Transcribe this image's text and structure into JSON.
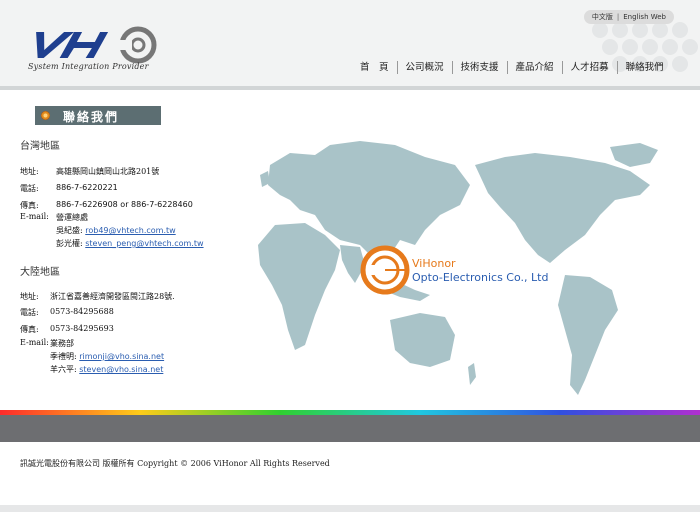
{
  "header": {
    "logo_tagline": "System Integration Provider",
    "lang_zh": "中文版",
    "lang_sep": "|",
    "lang_en": "English Web",
    "nav": [
      "首　頁",
      "公司概況",
      "技術支援",
      "產品介紹",
      "人才招募",
      "聯絡我們"
    ]
  },
  "page_title": "聯絡我們",
  "taiwan": {
    "region": "台灣地區",
    "address_label": "地址:",
    "address": "高雄縣岡山鎮岡山北路201號",
    "phone_label": "電話:",
    "phone": "886-7-6220221",
    "fax_label": "傳真:",
    "fax": "886-7-6226908 or 886-7-6228460",
    "email_label": "E-mail:",
    "dept": "營運總處",
    "contact1_name": "吳紀盛:",
    "contact1_email": "rob49@vhtech.com.tw",
    "contact2_name": "彭光權:",
    "contact2_email": "steven_peng@vhtech.com.tw"
  },
  "china": {
    "region": "大陸地區",
    "address_label": "地址:",
    "address": "浙江省嘉善經濟開發區閩江路28號.",
    "phone_label": "電話:",
    "phone": "0573-84295688",
    "fax_label": "傳真:",
    "fax": "0573-84295693",
    "email_label": "E-mail:",
    "dept": "業務部",
    "contact1_name": "季禮明:",
    "contact1_email": "rimonji@vho.sina.net",
    "contact2_name": "羊六平:",
    "contact2_email": "steven@vho.sina.net"
  },
  "map": {
    "company_line1": "ViHonor",
    "company_line2": "Opto-Electronics Co., Ltd"
  },
  "footer": {
    "copyright": "訊誠光電股份有限公司 版權所有 Copyright © 2006 ViHonor All Rights Reserved"
  },
  "colors": {
    "accent_orange": "#e67a1c",
    "map_land": "#a9c3c8",
    "banner": "#5c6e72",
    "link": "#2a5db0"
  }
}
